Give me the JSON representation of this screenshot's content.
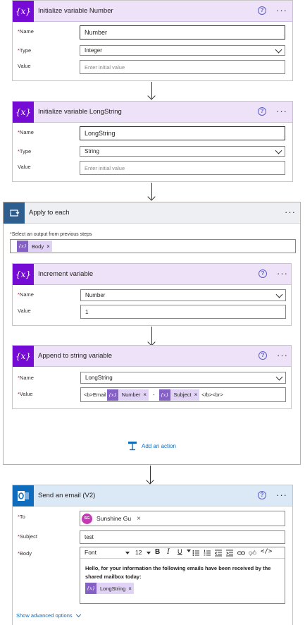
{
  "init_number": {
    "title": "Initialize variable Number",
    "icon": "{x}",
    "name_label": "Name",
    "name_value": "Number",
    "type_label": "Type",
    "type_value": "Integer",
    "value_label": "Value",
    "value_placeholder": "Enter initial value"
  },
  "init_longstring": {
    "title": "Initialize variable LongString",
    "icon": "{x}",
    "name_label": "Name",
    "name_value": "LongString",
    "type_label": "Type",
    "type_value": "String",
    "value_label": "Value",
    "value_placeholder": "Enter initial value"
  },
  "apply_each": {
    "title": "Apply to each",
    "select_label": "Select an output from previous steps",
    "token": "Body",
    "increment": {
      "title": "Increment variable",
      "icon": "{x}",
      "name_label": "Name",
      "name_value": "Number",
      "value_label": "Value",
      "value_value": "1"
    },
    "append": {
      "title": "Append to string variable",
      "icon": "{x}",
      "name_label": "Name",
      "name_value": "LongString",
      "value_label": "Value",
      "value_prefix": "<b>Email",
      "token_number": "Number",
      "separator": "-",
      "token_subject": "Subject",
      "value_suffix": "</b><br>"
    },
    "add_action": "Add an action"
  },
  "send_email": {
    "title": "Send an email (V2)",
    "to_label": "To",
    "to_initials": "SG",
    "to_name": "Sunshine Gu",
    "subject_label": "Subject",
    "subject_value": "test",
    "body_label": "Body",
    "font_value": "Font",
    "size_value": "12",
    "body_text": "Hello, for your information the following emails have been received by the shared mailbox today:",
    "body_token": "LongString",
    "advanced": "Show advanced options"
  },
  "token_icon": "{x}",
  "asterisk": "*",
  "remove_glyph": "×",
  "help_glyph": "?",
  "more_glyph": "···",
  "colors": {
    "variable": "#770bd6",
    "outlook": "#0f6cbd",
    "loop": "#2e5e8e"
  }
}
